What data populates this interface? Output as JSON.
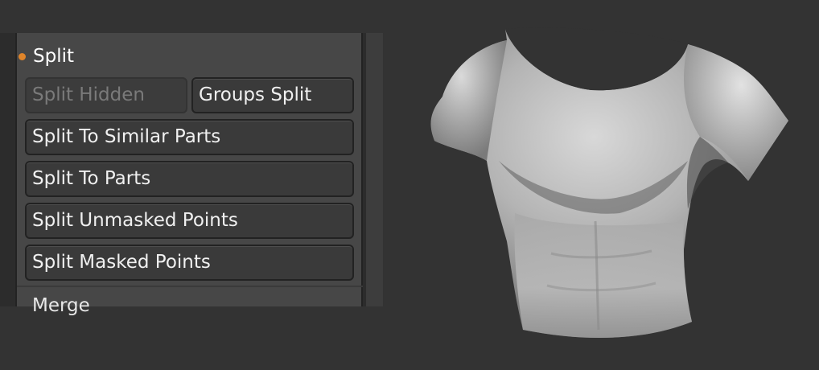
{
  "panel": {
    "section_title": "Split",
    "buttons": {
      "split_hidden": "Split Hidden",
      "groups_split": "Groups Split",
      "split_to_similar_parts": "Split To Similar Parts",
      "split_to_parts": "Split To Parts",
      "split_unmasked_points": "Split Unmasked Points",
      "split_masked_points": "Split Masked Points"
    },
    "next_section_title": "Merge"
  },
  "colors": {
    "background": "#333333",
    "panel": "#474747",
    "button": "#3a3a3a",
    "active_indicator": "#e0852a",
    "disabled_text": "#7a7a7a"
  },
  "viewport": {
    "model": "torso-mesh"
  }
}
